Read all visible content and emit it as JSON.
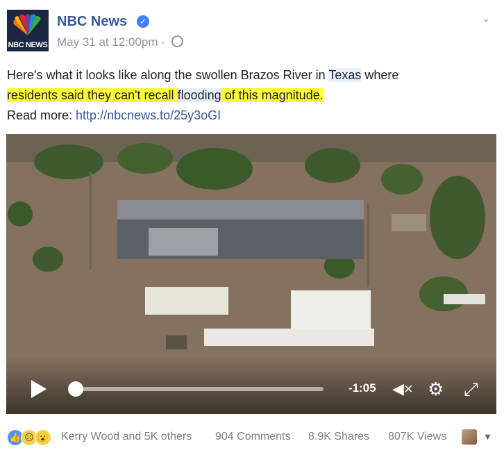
{
  "post": {
    "page_name": "NBC News",
    "logo_text": "NBC NEWS",
    "verified_icon": "✓",
    "date": "May 31 at 12:00pm",
    "separator": "·",
    "text": {
      "part1": "Here's what it looks like along the swollen Brazos River in ",
      "tag": "Texas",
      "part2": " where",
      "hl1": "residents said they can't recall ",
      "hl_tag": "flooding",
      "hl2": " of this magnitude.",
      "read_more": "Read more: ",
      "link": "http://nbcnews.to/25y3oGI"
    }
  },
  "video": {
    "time": "-1:05",
    "progress": 0.0,
    "mute_icon": "◀×",
    "gear_icon": "⚙",
    "expand_icon": "⤢"
  },
  "footer": {
    "reactions": [
      "like",
      "sad",
      "wow"
    ],
    "names": "Kerry Wood and 5K others",
    "comments": "904 Comments",
    "shares": "8.9K Shares",
    "views": "807K Views",
    "dropdown_icon": "▼"
  },
  "colors": {
    "brand": "#365899",
    "highlight": "#ffff33",
    "meta": "#90949c"
  }
}
